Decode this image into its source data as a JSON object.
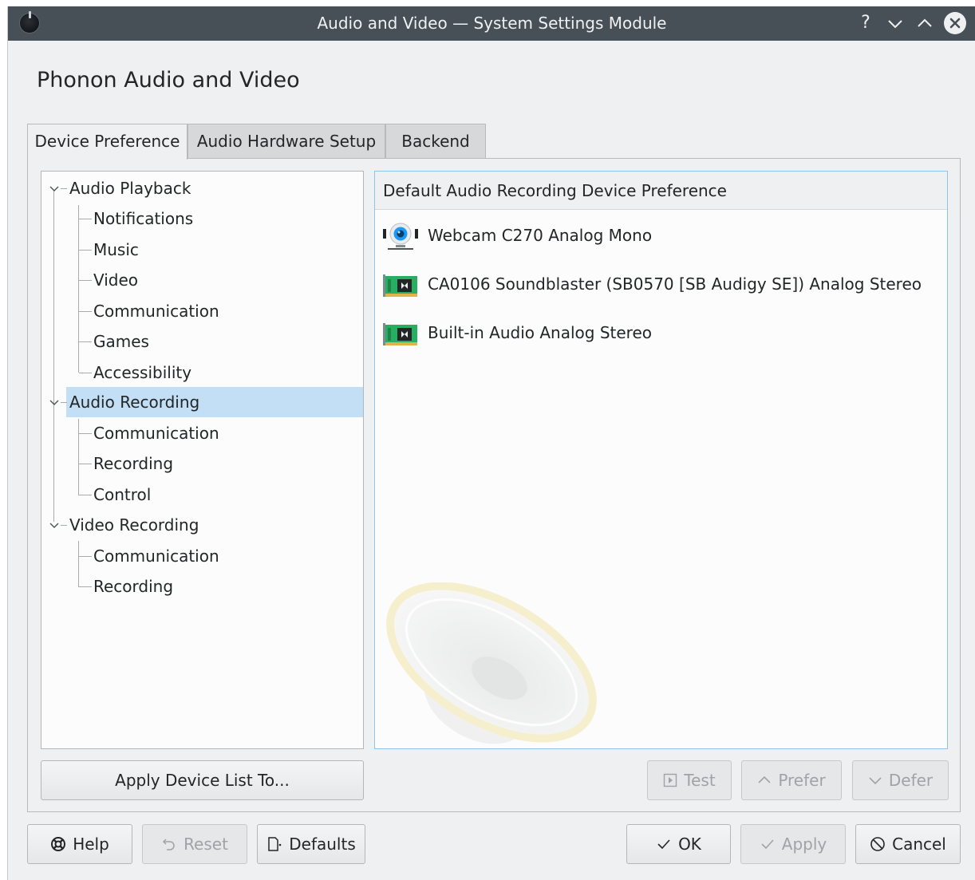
{
  "window": {
    "title": "Audio and Video — System Settings Module",
    "buttons": {
      "help": "?",
      "minimize": "⌄",
      "maximize": "⌃",
      "close": "✕"
    }
  },
  "heading": "Phonon Audio and Video",
  "tabs": [
    {
      "label": "Device Preference",
      "active": true
    },
    {
      "label": "Audio Hardware Setup",
      "active": false
    },
    {
      "label": "Backend",
      "active": false
    }
  ],
  "tree": {
    "groups": [
      {
        "label": "Audio Playback",
        "expanded": true,
        "selected": false,
        "children": [
          "Notifications",
          "Music",
          "Video",
          "Communication",
          "Games",
          "Accessibility"
        ]
      },
      {
        "label": "Audio Recording",
        "expanded": true,
        "selected": true,
        "children": [
          "Communication",
          "Recording",
          "Control"
        ]
      },
      {
        "label": "Video Recording",
        "expanded": true,
        "selected": false,
        "children": [
          "Communication",
          "Recording"
        ]
      }
    ]
  },
  "device_panel": {
    "header": "Default Audio Recording Device Preference",
    "devices": [
      {
        "label": "Webcam C270 Analog Mono",
        "icon": "webcam-icon"
      },
      {
        "label": "CA0106 Soundblaster (SB0570 [SB Audigy SE]) Analog Stereo",
        "icon": "sound-card-icon"
      },
      {
        "label": "Built-in Audio Analog Stereo",
        "icon": "sound-card-icon"
      }
    ]
  },
  "buttons": {
    "apply_device_list": "Apply Device List To...",
    "test": "Test",
    "prefer": "Prefer",
    "defer": "Defer",
    "help": "Help",
    "reset": "Reset",
    "defaults": "Defaults",
    "ok": "OK",
    "apply": "Apply",
    "cancel": "Cancel"
  },
  "colors": {
    "titlebar": "#475057",
    "selection": "#c2dff5",
    "focus_border": "#8fc4ea",
    "window_bg": "#eff0f1"
  }
}
